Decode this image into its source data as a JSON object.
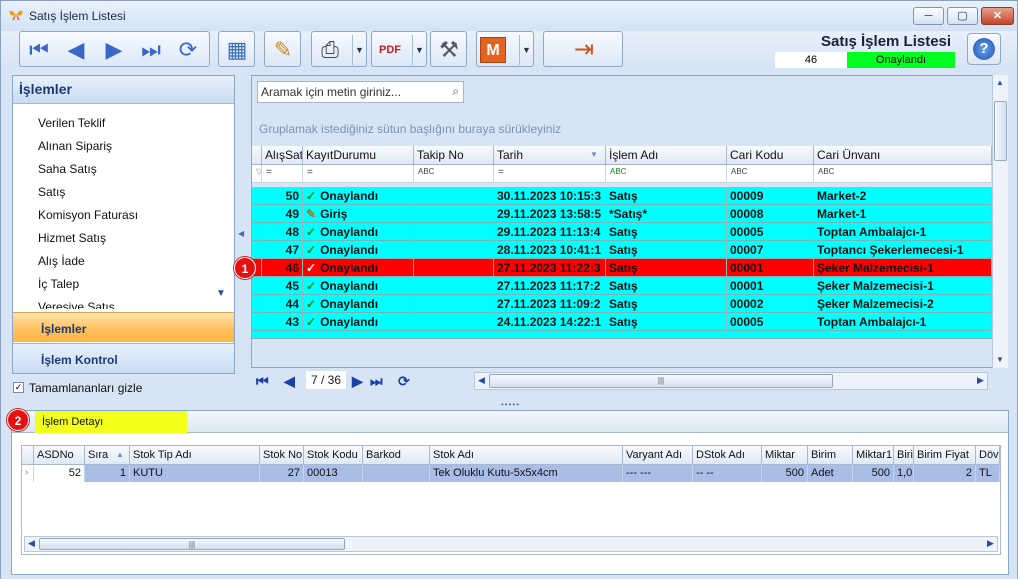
{
  "window": {
    "title": "Satış İşlem Listesi",
    "min": "─",
    "max": "▢",
    "close": "✕"
  },
  "header": {
    "title": "Satış İşlem Listesi",
    "record_no": "46",
    "status": "Onaylandı",
    "help": "?"
  },
  "toolbar": {
    "first": "⏮",
    "prev": "◀",
    "next": "▶",
    "last": "⏭",
    "refresh": "⟳",
    "grid_settings": "▦",
    "edit": "✎",
    "print": "⎙",
    "pdf": "PDF",
    "tools": "⚒",
    "m_label": "M",
    "exit": "⇥",
    "dropdown": "▼"
  },
  "left_panel": {
    "title": "İşlemler",
    "items": [
      "Verilen Teklif",
      "Alınan Sipariş",
      "Saha Satış",
      "Satış",
      "Komisyon Faturası",
      "Hizmet Satış",
      "Alış İade",
      "İç Talep",
      "Veresiye Satış"
    ],
    "active_button": "İşlemler",
    "control_button": "İşlem Kontrol",
    "hide_completed_label": "Tamamlananları gizle",
    "hide_completed_checked": true
  },
  "main_grid": {
    "search_placeholder": "Aramak için metin giriniz...",
    "group_hint": "Gruplamak istediğiniz sütun başlığını buraya sürükleyiniz",
    "columns": [
      "AlışSatış",
      "KayıtDurumu",
      "Takip No",
      "Tarih",
      "İşlem Adı",
      "Cari Kodu",
      "Cari Ünvanı"
    ],
    "filter_row": [
      "=",
      "=",
      "ABC",
      "=",
      "ABC",
      "ABC",
      "ABC"
    ],
    "rows": [
      {
        "id": "50",
        "status": "Onaylandı",
        "takip": "",
        "tarih": "30.11.2023 10:15:3",
        "islem": "Satış",
        "cari_kodu": "00009",
        "cari_unvan": "Market-2",
        "selected": false
      },
      {
        "id": "49",
        "status": "Giriş",
        "takip": "",
        "tarih": "29.11.2023 13:58:5",
        "islem": "*Satış*",
        "cari_kodu": "00008",
        "cari_unvan": "Market-1",
        "selected": false
      },
      {
        "id": "48",
        "status": "Onaylandı",
        "takip": "",
        "tarih": "29.11.2023 11:13:4",
        "islem": "Satış",
        "cari_kodu": "00005",
        "cari_unvan": "Toptan Ambalajcı-1",
        "selected": false
      },
      {
        "id": "47",
        "status": "Onaylandı",
        "takip": "",
        "tarih": "28.11.2023 10:41:1",
        "islem": "Satış",
        "cari_kodu": "00007",
        "cari_unvan": "Toptancı Şekerlemecesi-1",
        "selected": false
      },
      {
        "id": "46",
        "status": "Onaylandı",
        "takip": "",
        "tarih": "27.11.2023 11:22:3",
        "islem": "Satış",
        "cari_kodu": "00001",
        "cari_unvan": "Şeker Malzemecisi-1",
        "selected": true
      },
      {
        "id": "45",
        "status": "Onaylandı",
        "takip": "",
        "tarih": "27.11.2023 11:17:2",
        "islem": "Satış",
        "cari_kodu": "00001",
        "cari_unvan": "Şeker Malzemecisi-1",
        "selected": false
      },
      {
        "id": "44",
        "status": "Onaylandı",
        "takip": "",
        "tarih": "27.11.2023 11:09:2",
        "islem": "Satış",
        "cari_kodu": "00002",
        "cari_unvan": "Şeker Malzemecisi-2",
        "selected": false
      },
      {
        "id": "43",
        "status": "Onaylandı",
        "takip": "",
        "tarih": "24.11.2023 14:22:1",
        "islem": "Satış",
        "cari_kodu": "00005",
        "cari_unvan": "Toptan Ambalajcı-1",
        "selected": false
      }
    ],
    "pager_text": "7 / 36"
  },
  "badges": {
    "one": "1",
    "two": "2"
  },
  "detail": {
    "tab": "İşlem Detayı",
    "columns": [
      "ASDNo",
      "Sıra",
      "Stok Tip Adı",
      "Stok No",
      "Stok Kodu",
      "Barkod",
      "Stok Adı",
      "Varyant Adı",
      "DStok Adı",
      "Miktar",
      "Birim",
      "Miktar1",
      "Biri",
      "Birim Fiyat",
      "Dövi"
    ],
    "row": [
      "52",
      "1",
      "KUTU",
      "27",
      "00013",
      "",
      "Tek Oluklu Kutu-5x5x4cm",
      "--- ---",
      "-- --",
      "500",
      "Adet",
      "500",
      "1,0",
      "2",
      "TL"
    ]
  },
  "colors": {
    "row": "#00ffff",
    "selected_row": "#ff0000",
    "status_ok": "#00ff1e",
    "detail_tab": "#f2ff1a",
    "active_nav": "#ffc060"
  }
}
